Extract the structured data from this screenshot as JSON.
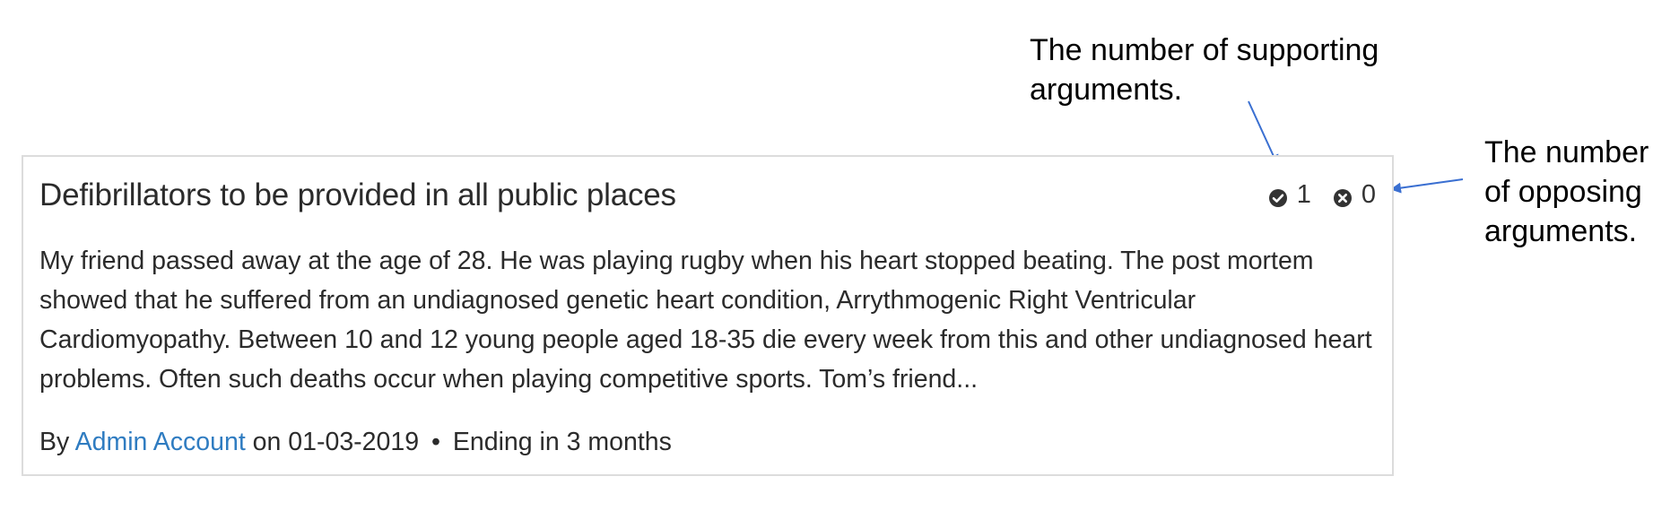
{
  "annotations": {
    "supporting_line1": "The number of supporting",
    "supporting_line2": "arguments.",
    "opposing_line1": "The number",
    "opposing_line2": "of opposing",
    "opposing_line3": "arguments."
  },
  "card": {
    "title": "Defibrillators to be provided in all public places",
    "supporting_count": "1",
    "opposing_count": "0",
    "body": "My friend passed away at the age of 28. He was playing rugby when his heart stopped beating. The post mortem showed that he suffered from an undiagnosed genetic heart condition, Arrythmogenic Right Ventricular Cardiomyopathy. Between 10 and 12 young people aged 18-35 die every week from this and other undiagnosed heart problems. Often such deaths occur when playing competitive sports. Tom’s friend...",
    "meta": {
      "by_label": "By",
      "author": "Admin Account",
      "date_text": "on 01-03-2019",
      "separator": "•",
      "ending": "Ending in 3 months"
    }
  },
  "icons": {
    "supporting": "check-circle-icon",
    "opposing": "x-circle-icon"
  },
  "colors": {
    "link": "#2f7cc1",
    "arrow": "#3a6fd1",
    "border": "#dcdcdc",
    "text": "#2b2b2b"
  }
}
